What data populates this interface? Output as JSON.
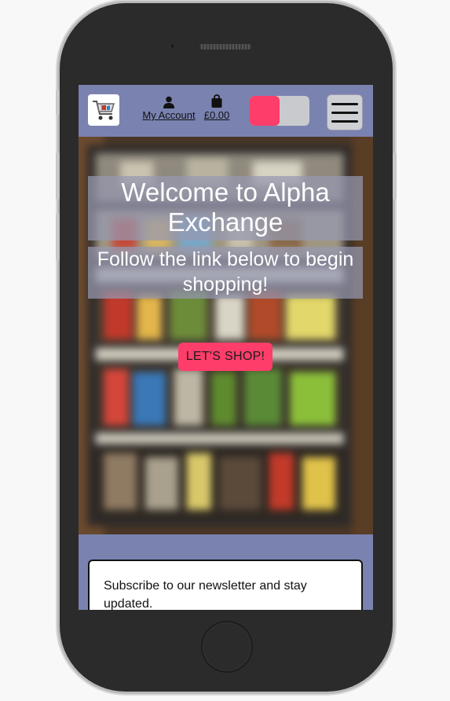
{
  "device": {
    "camera_icon": "camera-icon",
    "speaker_icon": "speaker-grille",
    "home_icon": "home-button"
  },
  "header": {
    "logo_icon": "shopping-cart-icon",
    "account_label": "My Account",
    "account_icon": "user-icon",
    "basket_total": "£0.00",
    "basket_icon": "shopping-bag-icon",
    "menu_icon": "hamburger-menu-icon",
    "theme_toggle_icon": "toggle-icon"
  },
  "hero": {
    "title": "Welcome to Alpha Exchange",
    "subtitle": "Follow the link below to begin shopping!",
    "cta_label": "LET'S SHOP!"
  },
  "newsletter": {
    "text": "Subscribe to our newsletter and stay updated."
  },
  "colors": {
    "header_bg": "#7a82b0",
    "accent": "#ff3d6a",
    "toggle_track": "#c8cacd"
  }
}
